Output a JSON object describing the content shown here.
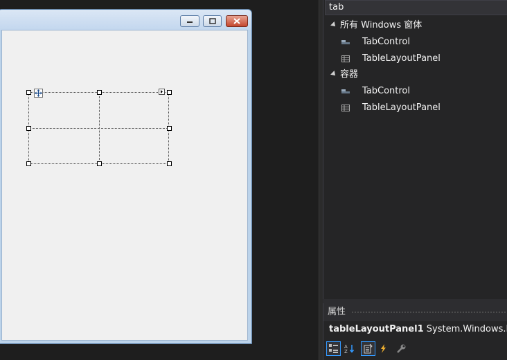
{
  "toolbox": {
    "search_text": "tab",
    "groups": [
      {
        "label": "所有 Windows 窗体",
        "items": [
          {
            "label": "TabControl",
            "icon": "tab-control-icon"
          },
          {
            "label": "TableLayoutPanel",
            "icon": "table-layout-panel-icon"
          }
        ]
      },
      {
        "label": "容器",
        "items": [
          {
            "label": "TabControl",
            "icon": "tab-control-icon"
          },
          {
            "label": "TableLayoutPanel",
            "icon": "table-layout-panel-icon"
          }
        ]
      }
    ]
  },
  "properties": {
    "title": "属性",
    "object_name": "tableLayoutPanel1",
    "object_type": "System.Windows.Form"
  },
  "colors": {
    "background": "#1e1e1e",
    "panel": "#252526",
    "accent": "#3399ff",
    "form_client": "#f0f0f0",
    "window_frame": "#bcd3ea",
    "close_button": "#c4462e"
  }
}
